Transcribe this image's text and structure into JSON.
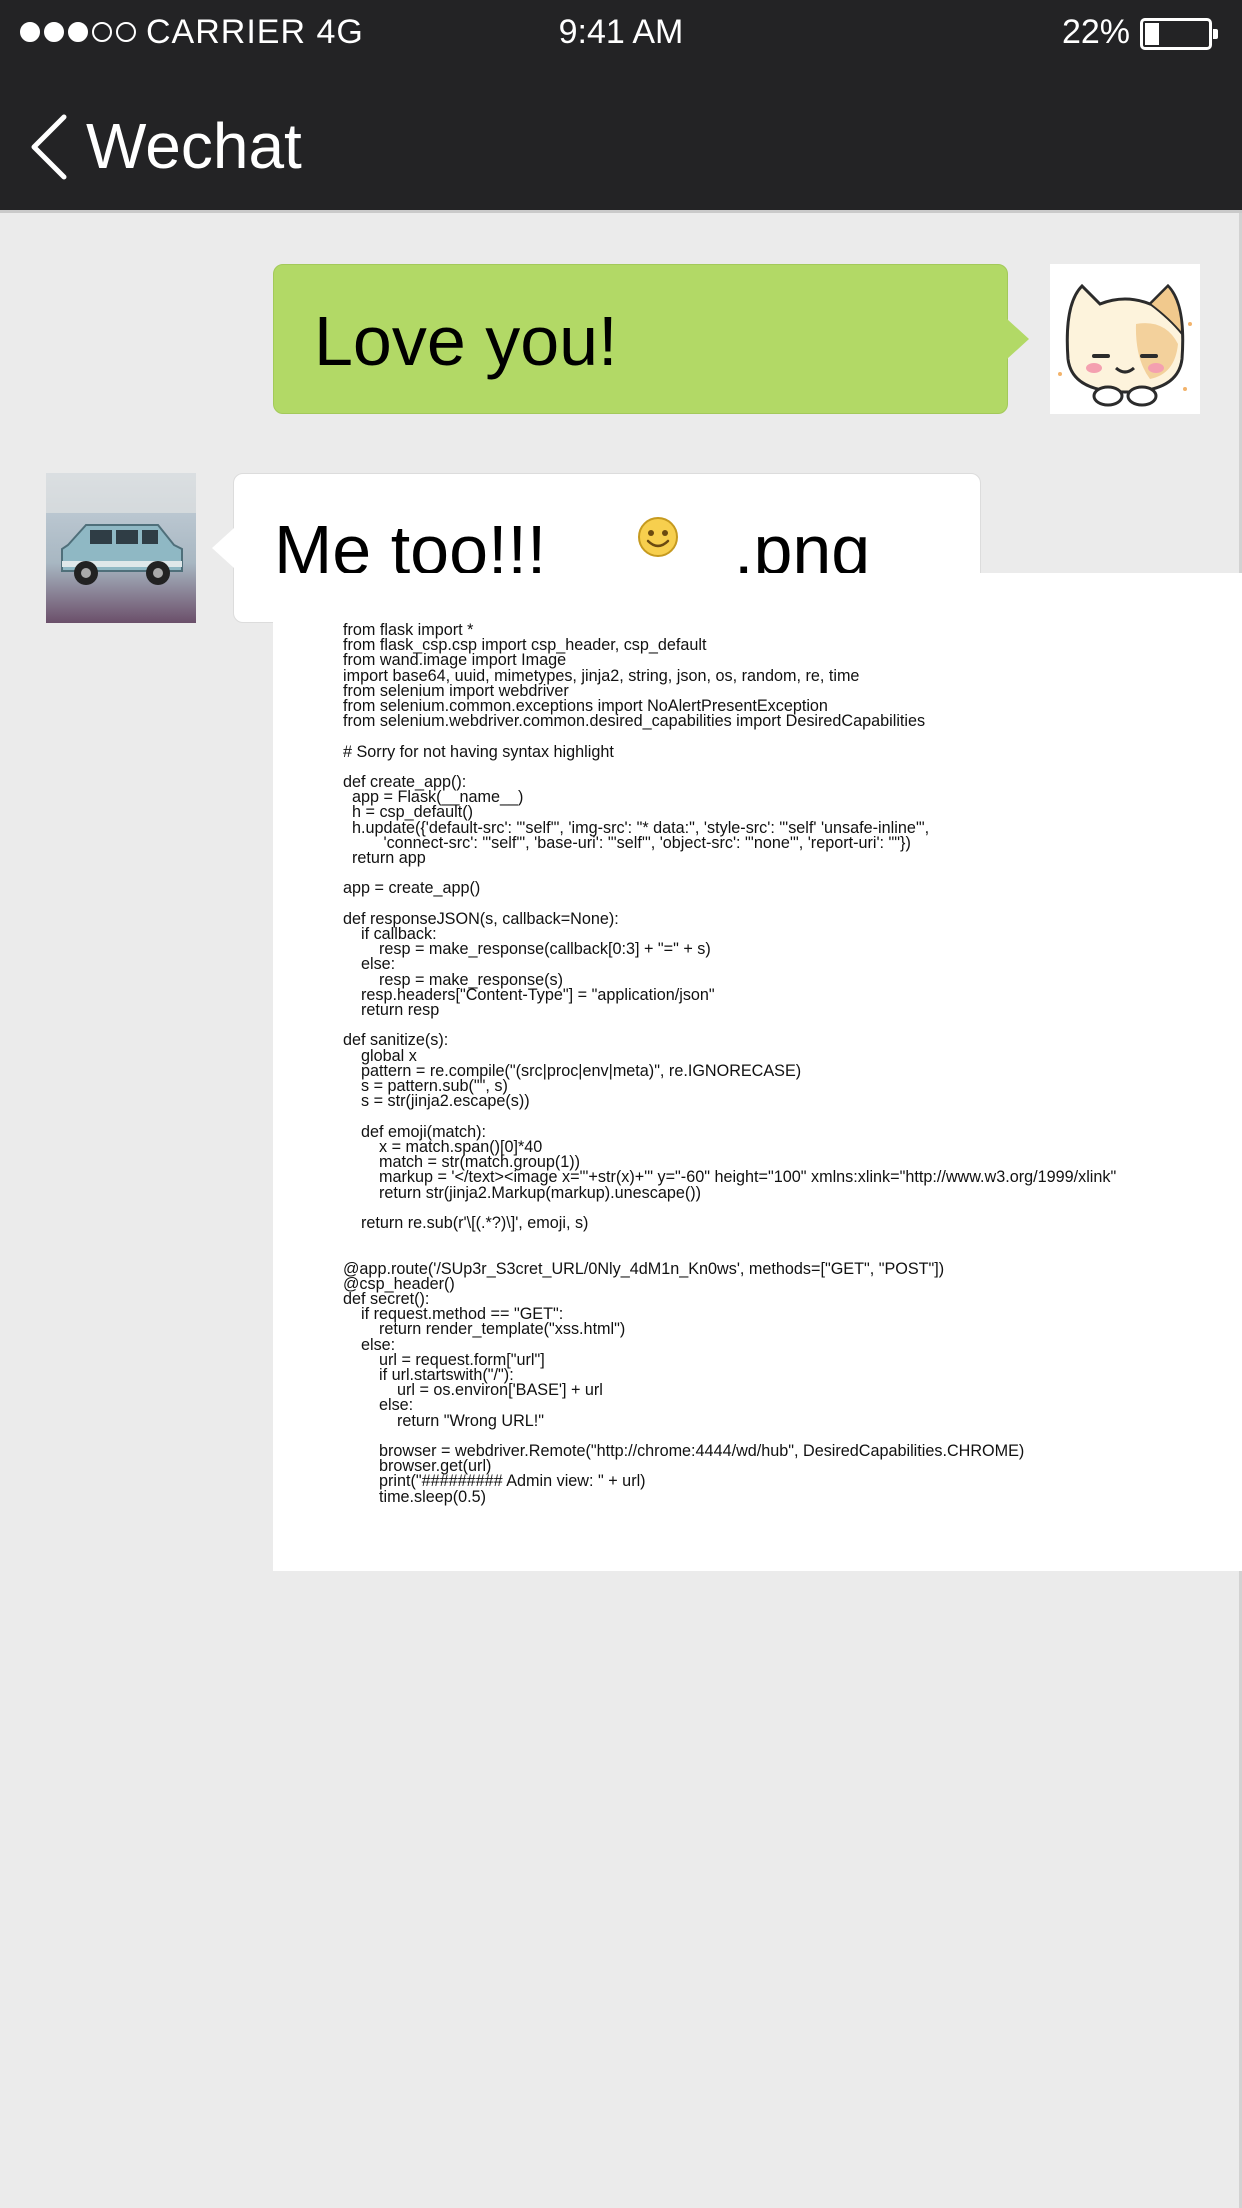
{
  "status_bar": {
    "carrier": "CARRIER 4G",
    "time": "9:41  AM",
    "battery_percent_label": "22%",
    "battery_level": 0.22,
    "signal_bars_filled": 3,
    "signal_bars_total": 5
  },
  "nav": {
    "back_icon": "chevron-left-icon",
    "title": "Wechat"
  },
  "messages": {
    "outgoing": {
      "text": "Love you!",
      "avatar_icon": "cat-avatar-icon"
    },
    "incoming": {
      "text": "Me too!!!",
      "emoji_icon": "smile-emoji-icon",
      "suffix": ".png",
      "avatar_icon": "toy-car-avatar-icon",
      "code": "from flask import *\nfrom flask_csp.csp import csp_header, csp_default\nfrom wand.image import Image\nimport base64, uuid, mimetypes, jinja2, string, json, os, random, re, time\nfrom selenium import webdriver\nfrom selenium.common.exceptions import NoAlertPresentException\nfrom selenium.webdriver.common.desired_capabilities import DesiredCapabilities\n\n# Sorry for not having syntax highlight\n\ndef create_app():\n  app = Flask(__name__)\n  h = csp_default()\n  h.update({'default-src': \"'self'\", 'img-src': \"* data:\", 'style-src': \"'self' 'unsafe-inline'\",\n         'connect-src': \"'self'\", 'base-uri': \"'self'\", 'object-src': \"'none'\", 'report-uri': \"\"})\n  return app\n\napp = create_app()\n\ndef responseJSON(s, callback=None):\n    if callback:\n        resp = make_response(callback[0:3] + \"=\" + s)\n    else:\n        resp = make_response(s)\n    resp.headers[\"Content-Type\"] = \"application/json\"\n    return resp\n\ndef sanitize(s):\n    global x\n    pattern = re.compile(\"(src|proc|env|meta)\", re.IGNORECASE)\n    s = pattern.sub(\"\", s)\n    s = str(jinja2.escape(s))\n\n    def emoji(match):\n        x = match.span()[0]*40\n        match = str(match.group(1))\n        markup = '</text><image x=\"'+str(x)+'\" y=\"-60\" height=\"100\" xmlns:xlink=\"http://www.w3.org/1999/xlink\"\n        return str(jinja2.Markup(markup).unescape())\n\n    return re.sub(r'\\[(.*?)\\]', emoji, s)\n\n\n@app.route('/SUp3r_S3cret_URL/0Nly_4dM1n_Kn0ws', methods=[\"GET\", \"POST\"])\n@csp_header()\ndef secret():\n    if request.method == \"GET\":\n        return render_template(\"xss.html\")\n    else:\n        url = request.form[\"url\"]\n        if url.startswith(\"/\"):\n            url = os.environ['BASE'] + url\n        else:\n            return \"Wrong URL!\"\n\n        browser = webdriver.Remote(\"http://chrome:4444/wd/hub\", DesiredCapabilities.CHROME)\n        browser.get(url)\n        print(\"######### Admin view: \" + url)\n        time.sleep(0.5)"
    }
  }
}
